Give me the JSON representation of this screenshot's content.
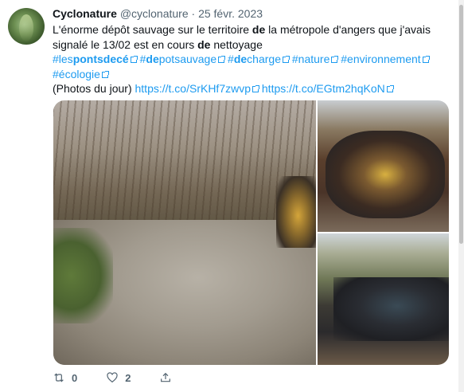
{
  "author": {
    "display_name": "Cyclonature",
    "handle": "@cyclonature",
    "separator": "·",
    "date": "25 févr. 2023"
  },
  "tweet": {
    "line1_a": "L'énorme dépôt sauvage sur le territoire ",
    "line1_b": "de",
    "line1_c": " la métropole d'angers que j'avais",
    "line2_a": "signalé le 13/02 est en cours ",
    "line2_b": "de",
    "line2_c": " nettoyage",
    "hashtags": [
      {
        "pre": "#les",
        "bold": "pontsdecé",
        "post": ""
      },
      {
        "pre": "#",
        "bold": "de",
        "post": "potsauvage"
      },
      {
        "pre": "#",
        "bold": "de",
        "post": "charge"
      },
      {
        "pre": "#nature",
        "bold": "",
        "post": ""
      },
      {
        "pre": "#environnement",
        "bold": "",
        "post": ""
      },
      {
        "pre": "#écologie",
        "bold": "",
        "post": ""
      }
    ],
    "photos_label": "(Photos du jour)",
    "link1": "https://t.co/SrKHf7zwvp",
    "link2": "https://t.co/EGtm2hqKoN"
  },
  "actions": {
    "retweet_count": "0",
    "like_count": "2"
  },
  "colors": {
    "link": "#1d9bf0",
    "muted": "#536471",
    "text": "#0f1419"
  },
  "icons": [
    "retweet-icon",
    "heart-icon",
    "share-icon",
    "external-link-icon"
  ]
}
